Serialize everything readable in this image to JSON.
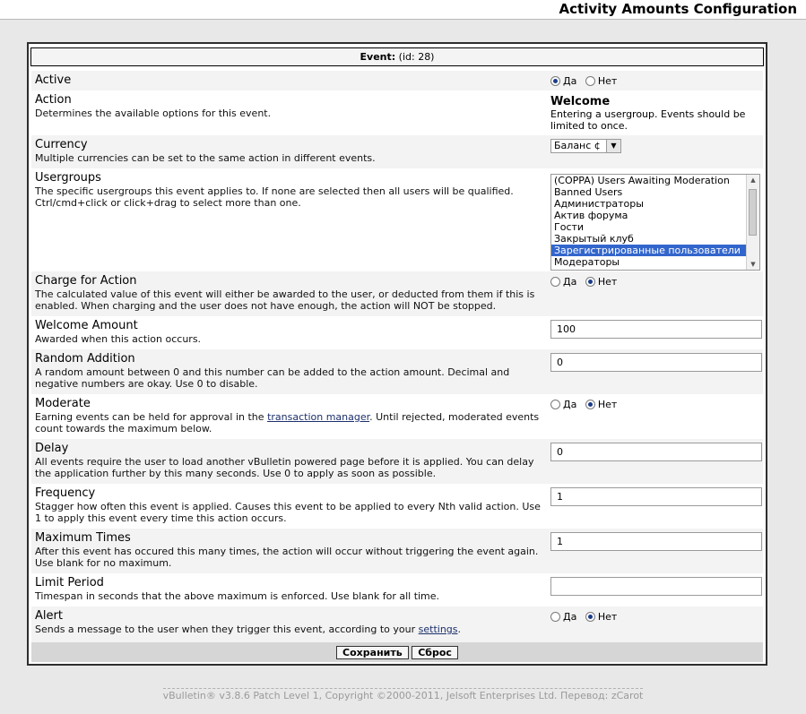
{
  "header": {
    "title": "Activity Amounts Configuration"
  },
  "panel": {
    "title_bold": "Event:",
    "title_id": "(id: 28)"
  },
  "rows": {
    "active": {
      "title": "Active",
      "opt_yes": "Да",
      "opt_no": "Нет",
      "selected": "yes"
    },
    "action": {
      "title": "Action",
      "desc": "Determines the available options for this event.",
      "value": "Welcome",
      "value_desc": "Entering a usergroup. Events should be limited to once."
    },
    "currency": {
      "title": "Currency",
      "desc": "Multiple currencies can be set to the same action in different events.",
      "value": "Баланс ¢"
    },
    "usergroups": {
      "title": "Usergroups",
      "desc": "The specific usergroups this event applies to. If none are selected then all users will be qualified. Ctrl/cmd+click or click+drag to select more than one.",
      "options": [
        "(COPPA) Users Awaiting Moderation",
        "Banned Users",
        "Администраторы",
        "Актив форума",
        "Гости",
        "Закрытый клуб",
        "Зарегистрированные пользователи",
        "Модераторы"
      ],
      "selected_index": 6
    },
    "charge": {
      "title": "Charge for Action",
      "desc": "The calculated value of this event will either be awarded to the user, or deducted from them if this is enabled. When charging and the user does not have enough, the action will NOT be stopped.",
      "opt_yes": "Да",
      "opt_no": "Нет",
      "selected": "no"
    },
    "welcome_amount": {
      "title": "Welcome Amount",
      "desc": "Awarded when this action occurs.",
      "value": "100"
    },
    "random_addition": {
      "title": "Random Addition",
      "desc": "A random amount between 0 and this number can be added to the action amount. Decimal and negative numbers are okay. Use 0 to disable.",
      "value": "0"
    },
    "moderate": {
      "title": "Moderate",
      "desc_before": "Earning events can be held for approval in the ",
      "desc_link": "transaction manager",
      "desc_after": ". Until rejected, moderated events count towards the maximum below.",
      "opt_yes": "Да",
      "opt_no": "Нет",
      "selected": "no"
    },
    "delay": {
      "title": "Delay",
      "desc": "All events require the user to load another vBulletin powered page before it is applied. You can delay the application further by this many seconds. Use 0 to apply as soon as possible.",
      "value": "0"
    },
    "frequency": {
      "title": "Frequency",
      "desc": "Stagger how often this event is applied. Causes this event to be applied to every Nth valid action. Use 1 to apply this event every time this action occurs.",
      "value": "1"
    },
    "max_times": {
      "title": "Maximum Times",
      "desc": "After this event has occured this many times, the action will occur without triggering the event again. Use blank for no maximum.",
      "value": "1"
    },
    "limit_period": {
      "title": "Limit Period",
      "desc": "Timespan in seconds that the above maximum is enforced. Use blank for all time.",
      "value": ""
    },
    "alert": {
      "title": "Alert",
      "desc_before": "Sends a message to the user when they trigger this event, according to your ",
      "desc_link": "settings",
      "desc_after": ".",
      "opt_yes": "Да",
      "opt_no": "Нет",
      "selected": "no"
    }
  },
  "buttons": {
    "save": "Сохранить",
    "reset": "Сброс"
  },
  "footer": {
    "copyright": "vBulletin® v3.8.6 Patch Level 1, Copyright ©2000-2011, Jelsoft Enterprises Ltd. Перевод: zCarot"
  }
}
